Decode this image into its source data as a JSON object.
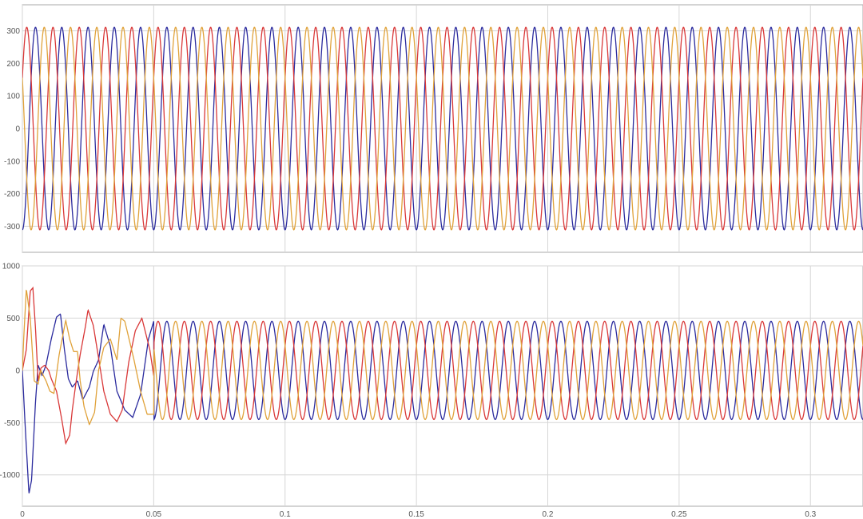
{
  "chart_data": [
    {
      "type": "line",
      "title": "",
      "xlabel": "",
      "ylabel": "",
      "xlim": [
        0,
        0.32
      ],
      "ylim": [
        -380,
        380
      ],
      "grid": true,
      "x_ticks": [
        0,
        0.05,
        0.1,
        0.15,
        0.2,
        0.25,
        0.3
      ],
      "y_ticks": [
        -300,
        -200,
        -100,
        0,
        100,
        200,
        300
      ],
      "y_tick_labels": [
        "-300",
        "-200",
        "-100",
        "0",
        "100",
        "200",
        "300"
      ],
      "series": [
        {
          "color": "#2b2b9e",
          "amplitude": 311,
          "frequency_hz": 100,
          "phase_deg": -90
        },
        {
          "color": "#d93838",
          "amplitude": 311,
          "frequency_hz": 100,
          "phase_deg": 30
        },
        {
          "color": "#e0a23a",
          "amplitude": 311,
          "frequency_hz": 100,
          "phase_deg": 150
        }
      ]
    },
    {
      "type": "line",
      "title": "",
      "xlabel": "",
      "ylabel": "",
      "xlim": [
        0,
        0.32
      ],
      "ylim": [
        -1300,
        1000
      ],
      "grid": true,
      "x_ticks": [
        0,
        0.05,
        0.1,
        0.15,
        0.2,
        0.25,
        0.3
      ],
      "x_tick_labels": [
        "0",
        "0.05",
        "0.1",
        "0.15",
        "0.2",
        "0.25",
        "0.3"
      ],
      "y_ticks": [
        -1000,
        -500,
        0,
        500,
        1000
      ],
      "y_tick_labels": [
        "-1000",
        "-500",
        "0",
        "500",
        "1000"
      ],
      "steady_amplitude": 470,
      "frequency_hz": 100,
      "series": [
        {
          "color": "#2b2b9e",
          "phase_deg": -90,
          "transient": [
            [
              0,
              0
            ],
            [
              0.001,
              -500
            ],
            [
              0.0025,
              -1180
            ],
            [
              0.0035,
              -1050
            ],
            [
              0.005,
              -300
            ],
            [
              0.006,
              50
            ],
            [
              0.0075,
              -50
            ],
            [
              0.009,
              50
            ],
            [
              0.011,
              300
            ],
            [
              0.013,
              510
            ],
            [
              0.0145,
              540
            ],
            [
              0.016,
              200
            ],
            [
              0.0175,
              -80
            ],
            [
              0.019,
              -160
            ],
            [
              0.021,
              -100
            ],
            [
              0.023,
              -280
            ],
            [
              0.0255,
              -160
            ],
            [
              0.027,
              -10
            ],
            [
              0.029,
              100
            ],
            [
              0.031,
              440
            ],
            [
              0.0335,
              230
            ],
            [
              0.036,
              -200
            ],
            [
              0.039,
              -380
            ],
            [
              0.042,
              -450
            ],
            [
              0.045,
              -230
            ],
            [
              0.048,
              300
            ],
            [
              0.05,
              470
            ]
          ]
        },
        {
          "color": "#d93838",
          "phase_deg": 30,
          "transient": [
            [
              0,
              0
            ],
            [
              0.0015,
              200
            ],
            [
              0.003,
              760
            ],
            [
              0.004,
              790
            ],
            [
              0.005,
              400
            ],
            [
              0.006,
              -100
            ],
            [
              0.007,
              20
            ],
            [
              0.0085,
              50
            ],
            [
              0.01,
              0
            ],
            [
              0.011,
              -80
            ],
            [
              0.013,
              -200
            ],
            [
              0.015,
              -470
            ],
            [
              0.0165,
              -700
            ],
            [
              0.018,
              -620
            ],
            [
              0.019,
              -380
            ],
            [
              0.0205,
              -100
            ],
            [
              0.022,
              150
            ],
            [
              0.024,
              420
            ],
            [
              0.025,
              580
            ],
            [
              0.027,
              430
            ],
            [
              0.029,
              120
            ],
            [
              0.031,
              -200
            ],
            [
              0.0335,
              -420
            ],
            [
              0.036,
              -490
            ],
            [
              0.038,
              -380
            ],
            [
              0.0405,
              80
            ],
            [
              0.043,
              380
            ],
            [
              0.0455,
              500
            ],
            [
              0.0485,
              200
            ],
            [
              0.05,
              -50
            ]
          ]
        },
        {
          "color": "#e0a23a",
          "phase_deg": 150,
          "transient": [
            [
              0,
              0
            ],
            [
              0.0005,
              300
            ],
            [
              0.0015,
              780
            ],
            [
              0.003,
              500
            ],
            [
              0.0045,
              -100
            ],
            [
              0.006,
              -130
            ],
            [
              0.007,
              0
            ],
            [
              0.009,
              -100
            ],
            [
              0.0105,
              -200
            ],
            [
              0.012,
              -220
            ],
            [
              0.014,
              150
            ],
            [
              0.0165,
              480
            ],
            [
              0.018,
              300
            ],
            [
              0.0195,
              180
            ],
            [
              0.021,
              180
            ],
            [
              0.022,
              -100
            ],
            [
              0.0235,
              -350
            ],
            [
              0.0255,
              -520
            ],
            [
              0.0275,
              -400
            ],
            [
              0.029,
              0
            ],
            [
              0.031,
              220
            ],
            [
              0.0335,
              300
            ],
            [
              0.036,
              100
            ],
            [
              0.0375,
              500
            ],
            [
              0.039,
              470
            ],
            [
              0.0425,
              100
            ],
            [
              0.045,
              -200
            ],
            [
              0.0475,
              -420
            ],
            [
              0.05,
              -420
            ]
          ]
        }
      ]
    }
  ]
}
